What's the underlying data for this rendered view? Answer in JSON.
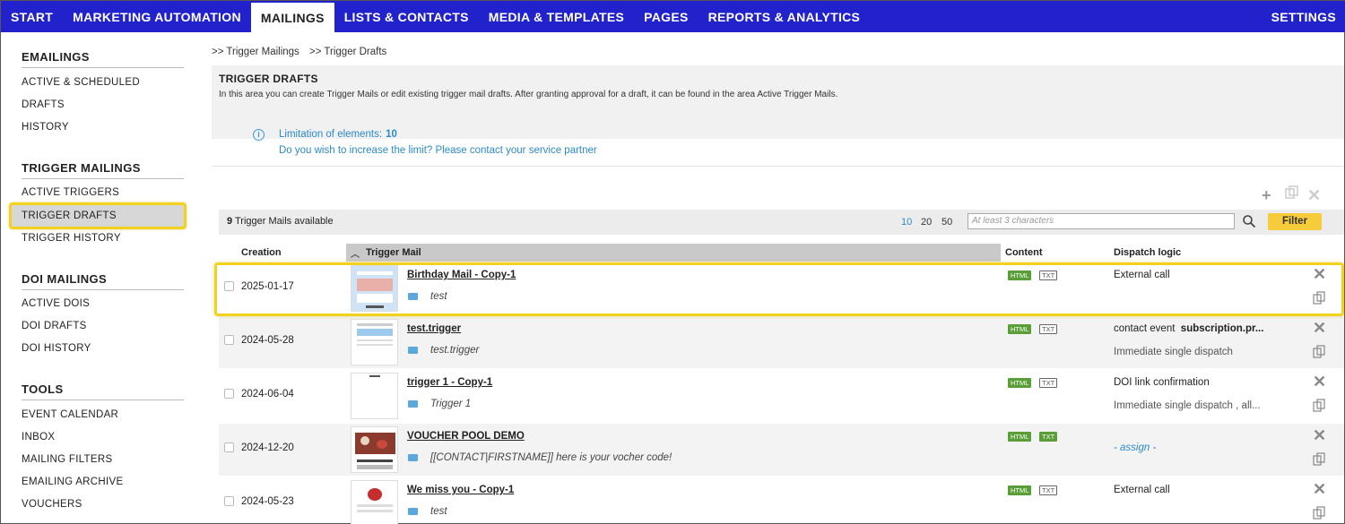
{
  "topnav": {
    "items": [
      "START",
      "MARKETING AUTOMATION",
      "MAILINGS",
      "LISTS & CONTACTS",
      "MEDIA & TEMPLATES",
      "PAGES",
      "REPORTS & ANALYTICS"
    ],
    "settings": "SETTINGS"
  },
  "sidebar": {
    "emailings": {
      "title": "EMAILINGS",
      "items": [
        "ACTIVE & SCHEDULED",
        "DRAFTS",
        "HISTORY"
      ]
    },
    "trigger": {
      "title": "TRIGGER MAILINGS",
      "items": [
        "ACTIVE TRIGGERS",
        "TRIGGER DRAFTS",
        "TRIGGER HISTORY"
      ]
    },
    "doi": {
      "title": "DOI MAILINGS",
      "items": [
        "ACTIVE DOIS",
        "DOI DRAFTS",
        "DOI HISTORY"
      ]
    },
    "tools": {
      "title": "TOOLS",
      "items": [
        "EVENT CALENDAR",
        "INBOX",
        "MAILING FILTERS",
        "EMAILING ARCHIVE",
        "VOUCHERS"
      ]
    }
  },
  "breadcrumb": [
    ">> Trigger Mailings",
    ">> Trigger Drafts"
  ],
  "info": {
    "title": "TRIGGER DRAFTS",
    "description": "In this area you can create Trigger Mails or edit existing trigger mail drafts. After granting approval for a draft, it can be found in the area Active Trigger Mails."
  },
  "limit": {
    "label": "Limitation of elements:",
    "value": "10",
    "cta": "Do you wish to increase the limit? Please contact your service partner"
  },
  "toolbar": {
    "count": "9",
    "count_label": "Trigger Mails available",
    "page_sizes": [
      "10",
      "20",
      "50"
    ],
    "search_placeholder": "At least 3 characters",
    "filter": "Filter"
  },
  "columns": {
    "creation": "Creation",
    "mail": "Trigger Mail",
    "content": "Content",
    "dispatch": "Dispatch logic"
  },
  "rows": [
    {
      "date": "2025-01-17",
      "name": "Birthday Mail - Copy-1",
      "subject": "test",
      "html": "HTML",
      "txt": "TXT",
      "dispatch1": "External call",
      "dispatch1_bold": "",
      "dispatch2": ""
    },
    {
      "date": "2024-05-28",
      "name": "test.trigger",
      "subject": "test.trigger",
      "html": "HTML",
      "txt": "TXT",
      "dispatch1": "contact event",
      "dispatch1_bold": "subscription.pr...",
      "dispatch2": "Immediate single dispatch"
    },
    {
      "date": "2024-06-04",
      "name": "trigger 1 - Copy-1",
      "subject": "Trigger 1",
      "html": "HTML",
      "txt": "TXT",
      "dispatch1": "DOI link confirmation",
      "dispatch1_bold": "",
      "dispatch2": "Immediate single dispatch , all..."
    },
    {
      "date": "2024-12-20",
      "name": "VOUCHER POOL DEMO",
      "subject": "[[CONTACT|FIRSTNAME]] here is your vocher code!",
      "html": "HTML",
      "txt": "TXT",
      "assign": "- assign -"
    },
    {
      "date": "2024-05-23",
      "name": "We miss you - Copy-1",
      "subject": "test",
      "html": "HTML",
      "txt": "TXT",
      "dispatch1": "External call",
      "dispatch1_bold": "",
      "dispatch2": ""
    }
  ]
}
